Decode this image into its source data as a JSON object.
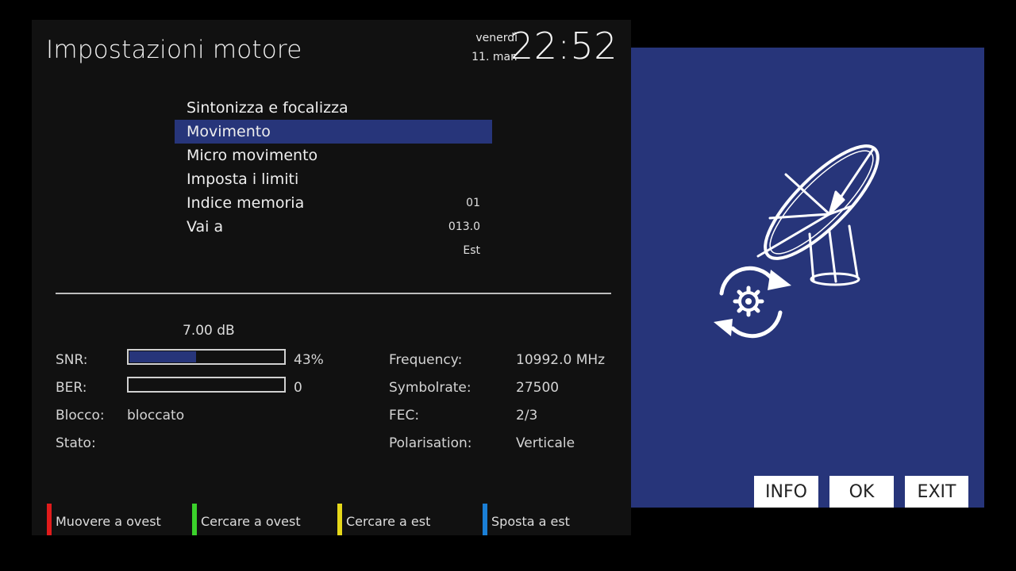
{
  "header": {
    "title": "Impostazioni motore",
    "day": "venerdì",
    "date": "11. mar.",
    "time": "22:52"
  },
  "menu": {
    "items": [
      {
        "label": "Sintonizza e focalizza",
        "value": ""
      },
      {
        "label": "Movimento",
        "value": "",
        "selected": true
      },
      {
        "label": "Micro movimento",
        "value": ""
      },
      {
        "label": "Imposta i limiti",
        "value": ""
      },
      {
        "label": "Indice memoria",
        "value": "01"
      },
      {
        "label": "Vai a",
        "value": "013.0"
      }
    ],
    "extra_value": "Est"
  },
  "signal": {
    "snr_db": "7.00 dB",
    "snr_label": "SNR:",
    "snr_percent": "43%",
    "snr_level": 0.43,
    "ber_label": "BER:",
    "ber_value": "0",
    "ber_level": 0,
    "lock_label": "Blocco:",
    "lock_value": "bloccato",
    "state_label": "Stato:",
    "state_value": ""
  },
  "tuner": {
    "frequency_label": "Frequency:",
    "frequency_value": "10992.0 MHz",
    "symbolrate_label": "Symbolrate:",
    "symbolrate_value": "27500",
    "fec_label": "FEC:",
    "fec_value": "2/3",
    "polarisation_label": "Polarisation:",
    "polarisation_value": "Verticale"
  },
  "color_keys": [
    {
      "label": "Muovere a ovest",
      "color": "#e01b1b"
    },
    {
      "label": "Cercare a ovest",
      "color": "#3bd12b"
    },
    {
      "label": "Cercare a est",
      "color": "#e6d81a"
    },
    {
      "label": "Sposta a est",
      "color": "#1a7fd6"
    }
  ],
  "side_buttons": {
    "info": "INFO",
    "ok": "OK",
    "exit": "EXIT"
  },
  "side_icon": "satellite-dish-motor-icon",
  "colors": {
    "accent": "#27357a",
    "panel": "#111111"
  }
}
